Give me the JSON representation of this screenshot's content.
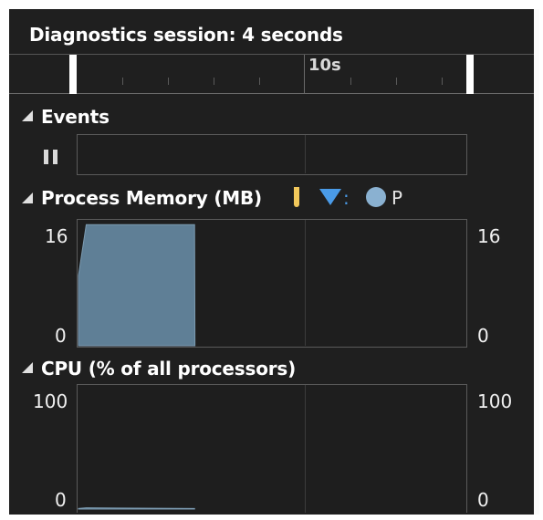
{
  "session": {
    "title": "Diagnostics session: 4 seconds"
  },
  "timeline": {
    "label": "10s"
  },
  "events": {
    "title": "Events"
  },
  "memory": {
    "title": "Process Memory (MB)",
    "legend": [
      {
        "icon": "snapshot-marker-icon",
        "color": "#f2c85b"
      },
      {
        "icon": "gc-triangle-icon",
        "color": "#4a9be8",
        "label": ":"
      },
      {
        "icon": "private-bytes-circle-icon",
        "color": "#8ab1d1",
        "label": "P"
      }
    ],
    "y_top": "16",
    "y_bottom": "0",
    "y_top_right": "16",
    "y_bottom_right": "0"
  },
  "cpu": {
    "title": "CPU (% of all processors)",
    "y_top": "100",
    "y_bottom": "0",
    "y_top_right": "100",
    "y_bottom_right": "0"
  },
  "colors": {
    "background": "#1f1f1f",
    "memory_fill": "#5f7f96",
    "cpu_fill": "#5f7f96"
  },
  "chart_data": [
    {
      "type": "area",
      "x": [
        0,
        0.2,
        1.5,
        3.0,
        3.01
      ],
      "series": [
        {
          "values": [
            9,
            15.5,
            15.5,
            15.5,
            0
          ]
        }
      ],
      "ylim": [
        0,
        16
      ]
    },
    {
      "type": "area",
      "x": [
        0,
        0.2,
        3.0
      ],
      "series": [
        {
          "values": [
            0.5,
            1,
            0.5
          ]
        }
      ],
      "ylim": [
        0,
        100
      ]
    }
  ]
}
